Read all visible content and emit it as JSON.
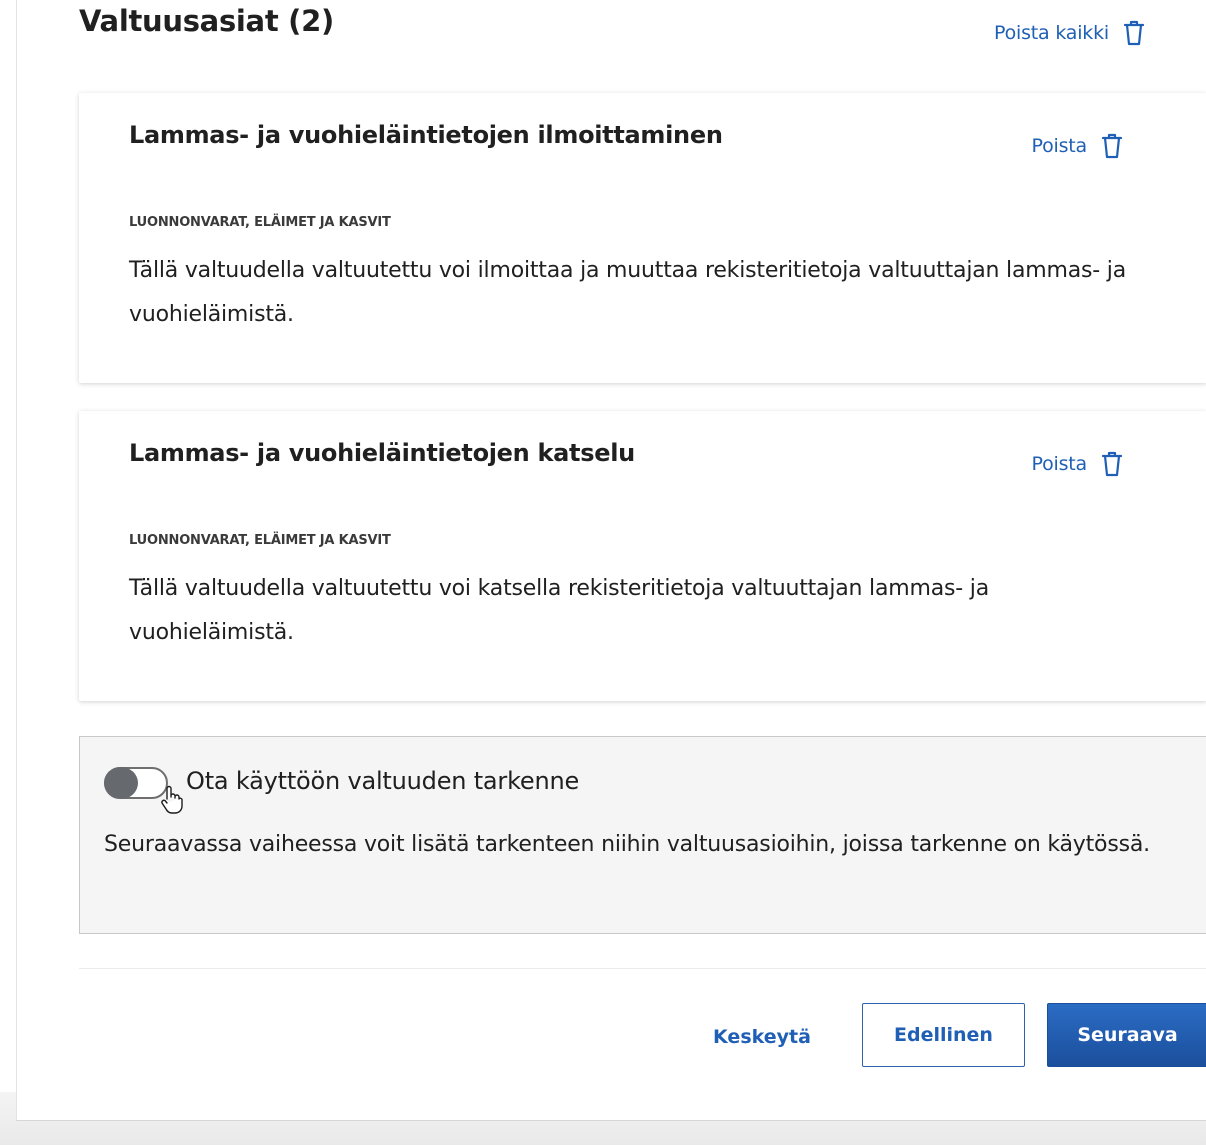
{
  "section": {
    "title": "Valtuusasiat (2)",
    "remove_all_label": "Poista kaikki"
  },
  "cards": [
    {
      "title": "Lammas- ja vuohieläintietojen ilmoittaminen",
      "remove_label": "Poista",
      "category": "LUONNONVARAT, ELÄIMET JA KASVIT",
      "description": "Tällä valtuudella valtuutettu voi ilmoittaa ja muuttaa rekisteritietoja valtuuttajan lammas- ja vuohieläimistä."
    },
    {
      "title": "Lammas- ja vuohieläintietojen katselu",
      "remove_label": "Poista",
      "category": "LUONNONVARAT, ELÄIMET JA KASVIT",
      "description": "Tällä valtuudella valtuutettu voi katsella rekisteritietoja valtuuttajan lammas- ja vuohieläimistä."
    }
  ],
  "refinement": {
    "toggle_label": "Ota käyttöön valtuuden tarkenne",
    "toggle_on": false,
    "description": "Seuraavassa vaiheessa voit lisätä tarkenteen niihin valtuusasioihin, joissa tarkenne on käytössä."
  },
  "footer": {
    "cancel_label": "Keskeytä",
    "previous_label": "Edellinen",
    "next_label": "Seuraava"
  },
  "colors": {
    "link": "#1f5fb5",
    "primary_button": "#1b4f9c",
    "toggle_knob": "#666a6e"
  }
}
